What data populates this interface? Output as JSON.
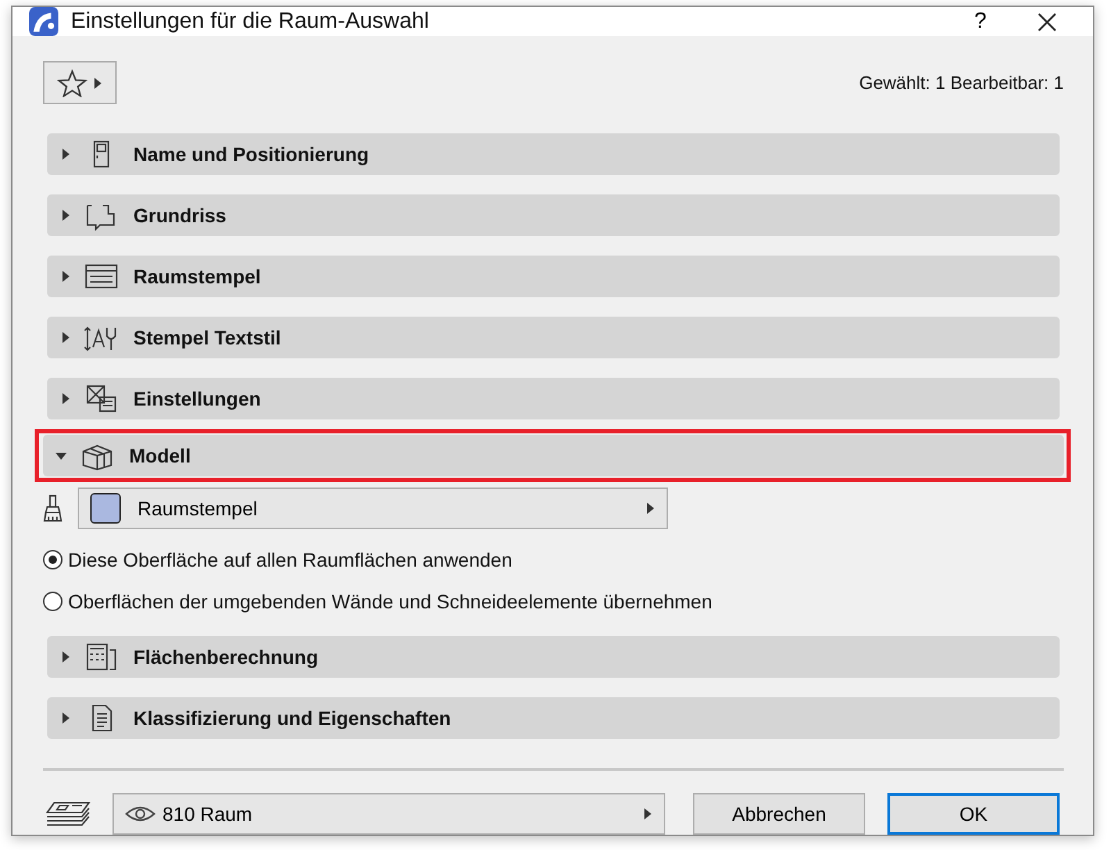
{
  "window": {
    "title": "Einstellungen für die Raum-Auswahl",
    "help": "?"
  },
  "selection_info": "Gewählt: 1 Bearbeitbar: 1",
  "sections": [
    {
      "title": "Name und Positionierung",
      "expanded": false,
      "highlighted": false
    },
    {
      "title": "Grundriss",
      "expanded": false,
      "highlighted": false
    },
    {
      "title": "Raumstempel",
      "expanded": false,
      "highlighted": false
    },
    {
      "title": "Stempel Textstil",
      "expanded": false,
      "highlighted": false
    },
    {
      "title": "Einstellungen",
      "expanded": false,
      "highlighted": false
    },
    {
      "title": "Modell",
      "expanded": true,
      "highlighted": true,
      "surface": {
        "value": "Raumstempel",
        "color": "#aab8e0"
      },
      "options": [
        {
          "label": "Diese Oberfläche auf allen Raumflächen anwenden",
          "selected": true
        },
        {
          "label": "Oberflächen der umgebenden Wände und Schneideelemente übernehmen",
          "selected": false
        }
      ]
    },
    {
      "title": "Flächenberechnung",
      "expanded": false,
      "highlighted": false
    },
    {
      "title": "Klassifizierung und Eigenschaften",
      "expanded": false,
      "highlighted": false
    }
  ],
  "footer": {
    "layer": "810 Raum",
    "buttons": [
      {
        "label": "Abbrechen",
        "default": false
      },
      {
        "label": "OK",
        "default": true
      }
    ]
  }
}
